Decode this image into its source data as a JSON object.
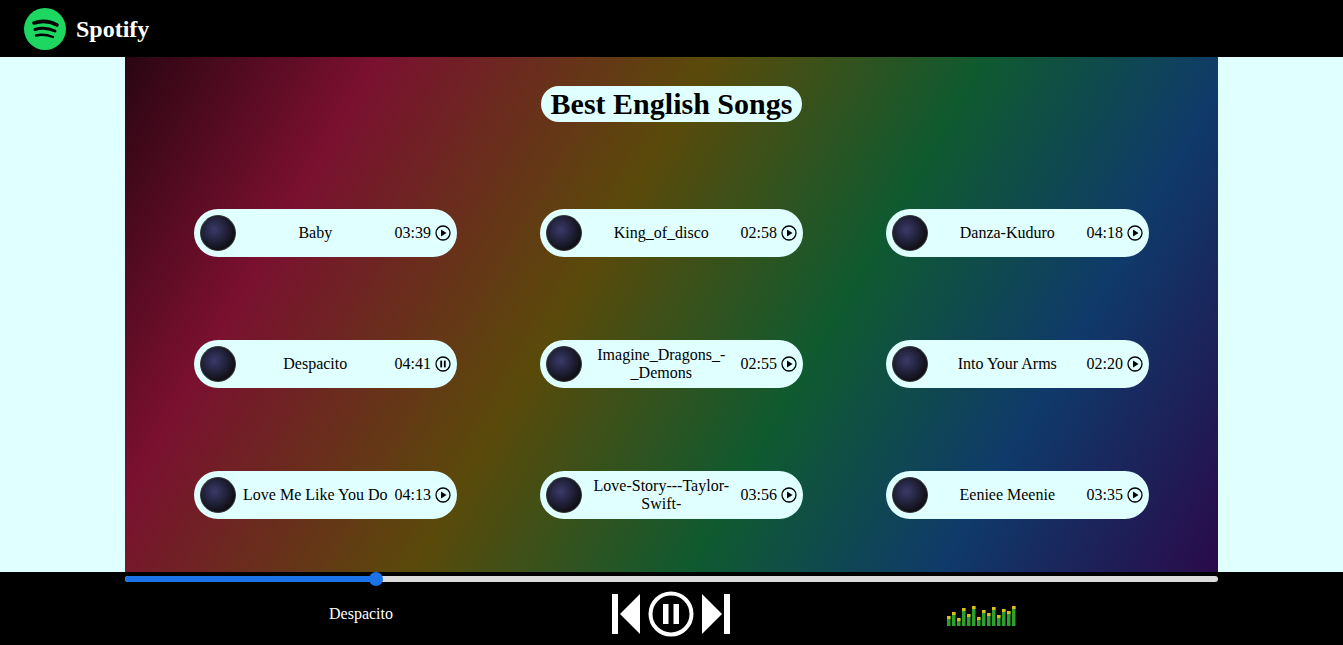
{
  "header": {
    "brand": "Spotify"
  },
  "playlist": {
    "title": "Best English Songs"
  },
  "songs": [
    {
      "name": "Baby",
      "duration": "03:39",
      "playing": false
    },
    {
      "name": "King_of_disco",
      "duration": "02:58",
      "playing": false
    },
    {
      "name": "Danza-Kuduro",
      "duration": "04:18",
      "playing": false
    },
    {
      "name": "Despacito",
      "duration": "04:41",
      "playing": true
    },
    {
      "name": "Imagine_Dragons_-_Demons",
      "duration": "02:55",
      "playing": false
    },
    {
      "name": "Into Your Arms",
      "duration": "02:20",
      "playing": false
    },
    {
      "name": "Love Me Like You Do",
      "duration": "04:13",
      "playing": false
    },
    {
      "name": "Love-Story---Taylor-Swift-",
      "duration": "03:56",
      "playing": false
    },
    {
      "name": "Eeniee Meenie",
      "duration": "03:35",
      "playing": false
    }
  ],
  "player": {
    "current": "Despacito",
    "level": 0.23,
    "playing": true
  }
}
